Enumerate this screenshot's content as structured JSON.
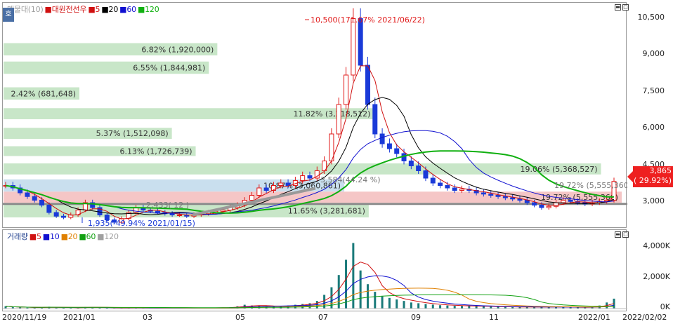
{
  "main_legend": [
    {
      "text": "매물대(10)",
      "color": "#a0a0a0"
    },
    {
      "text": "대원전선우",
      "color": "#d01010"
    },
    {
      "text": "5",
      "color": "#d01010"
    },
    {
      "text": "20",
      "color": "#000000"
    },
    {
      "text": "60",
      "color": "#1010d0"
    },
    {
      "text": "120",
      "color": "#10b010"
    }
  ],
  "volume_legend": [
    {
      "text": "거래량",
      "color": "#1a3a8a"
    },
    {
      "text": "5",
      "color": "#d01010"
    },
    {
      "text": "10",
      "color": "#1010d0"
    },
    {
      "text": "20",
      "color": "#e08000"
    },
    {
      "text": "60",
      "color": "#10a010"
    },
    {
      "text": "120",
      "color": "#a0a0a0"
    }
  ],
  "mode_button": "호",
  "price_axis": [
    "10,500",
    "9,000",
    "7,500",
    "6,000",
    "4,500",
    "3,000"
  ],
  "volume_axis": [
    "4,000K",
    "2,000K",
    "0K"
  ],
  "date_axis": [
    "2020/11/19",
    "2021/01",
    "03",
    "05",
    "07",
    "09",
    "11",
    "2022/01",
    "2022/02/02"
  ],
  "current_price": {
    "value": "3,865",
    "change": "( 29.92%)"
  },
  "annotations": {
    "high": "10,500(171.67% 2021/06/22)",
    "low": "1,935(-49.94% 2021/01/15)",
    "mid": "3,584(44.24 %)",
    "right": "19.72% (5,555,360)",
    "left_small": "2,433(  12  )"
  },
  "chart_data": {
    "type": "bar",
    "title": "대원전선우",
    "ylim": [
      2000,
      11000
    ],
    "volume_profile": [
      {
        "range": [
          9000,
          9500
        ],
        "pct": "6.82%",
        "vol": "1,920,000"
      },
      {
        "range": [
          8250,
          8750
        ],
        "pct": "6.55%",
        "vol": "1,844,981"
      },
      {
        "range": [
          7200,
          7700
        ],
        "pct": "2.42%",
        "vol": "681,648"
      },
      {
        "range": [
          6400,
          6850
        ],
        "pct": "11.82%",
        "vol": "3,218,512"
      },
      {
        "range": [
          5600,
          6050
        ],
        "pct": "5.37%",
        "vol": "1,512,098"
      },
      {
        "range": [
          4900,
          5300
        ],
        "pct": "6.13%",
        "vol": "1,726,739"
      },
      {
        "range": [
          4150,
          4600
        ],
        "pct": "19.06%",
        "vol": "5,368,527"
      },
      {
        "range": [
          3450,
          3950
        ],
        "pct": "10.87%",
        "vol": "3,060,861"
      },
      {
        "range": [
          3000,
          3450
        ],
        "pct": "19.72%",
        "vol": "5,555,360"
      },
      {
        "range": [
          2400,
          2950
        ],
        "pct": "11.65%",
        "vol": "3,281,681"
      }
    ],
    "price_series": [
      3700,
      3600,
      3400,
      3250,
      3100,
      2900,
      2600,
      2450,
      2400,
      2500,
      2700,
      3000,
      2800,
      2500,
      2300,
      2200,
      2350,
      2600,
      2800,
      2700,
      2650,
      2600,
      2550,
      2500,
      2500,
      2450,
      2500,
      2550,
      2600,
      2650,
      2700,
      2800,
      2900,
      3100,
      3300,
      3600,
      3500,
      3700,
      3800,
      3700,
      3900,
      4100,
      4000,
      4300,
      4700,
      5800,
      7000,
      8200,
      10500,
      8600,
      7000,
      5800,
      5400,
      5200,
      5000,
      4700,
      4500,
      4300,
      4000,
      3800,
      3700,
      3600,
      3500,
      3550,
      3500,
      3400,
      3350,
      3300,
      3250,
      3200,
      3150,
      3100,
      3000,
      2900,
      2800,
      2850,
      3000,
      3100,
      3050,
      3000,
      2950,
      3000,
      3050,
      3100,
      3865
    ],
    "volume_series_k": [
      150,
      90,
      70,
      60,
      60,
      80,
      120,
      60,
      50,
      60,
      70,
      100,
      80,
      60,
      50,
      40,
      50,
      70,
      60,
      50,
      40,
      40,
      40,
      30,
      30,
      30,
      30,
      40,
      50,
      60,
      70,
      80,
      150,
      250,
      200,
      180,
      150,
      160,
      150,
      200,
      250,
      300,
      350,
      500,
      900,
      1400,
      2200,
      3200,
      4300,
      2500,
      1600,
      1100,
      800,
      700,
      600,
      500,
      400,
      350,
      300,
      260,
      220,
      200,
      180,
      170,
      160,
      150,
      140,
      130,
      120,
      110,
      100,
      100,
      90,
      90,
      100,
      110,
      100,
      90,
      80,
      80,
      90,
      100,
      200,
      400,
      650
    ]
  }
}
